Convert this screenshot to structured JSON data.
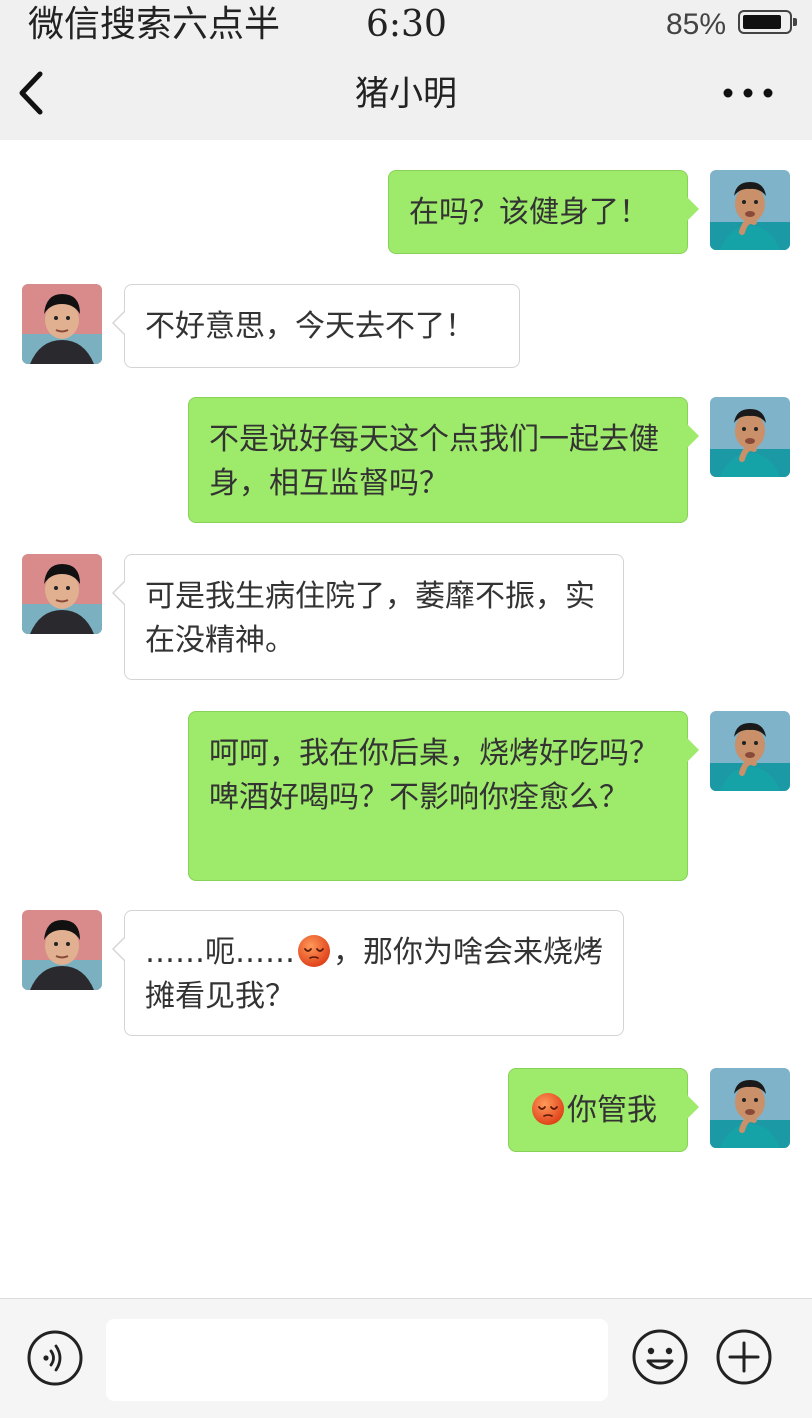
{
  "status_bar": {
    "carrier": "微信搜索六点半",
    "time": "6:30",
    "battery": "85%",
    "battery_level": 0.85
  },
  "header": {
    "back_icon": "chevron-left-icon",
    "title": "猪小明",
    "more_icon": "more-dots-icon"
  },
  "messages": [
    {
      "side": "sent",
      "text": "在吗？该健身了！"
    },
    {
      "side": "received",
      "text": "不好意思，今天去不了！"
    },
    {
      "side": "sent",
      "text": "不是说好每天这个点我们一起去健身，相互监督吗？"
    },
    {
      "side": "received",
      "text": "可是我生病住院了，萎靡不振，实在没精神。"
    },
    {
      "side": "sent",
      "text": "呵呵，我在你后桌，烧烤好吃吗？啤酒好喝吗？不影响你痊愈么？"
    },
    {
      "side": "received",
      "text_before": "……呃……",
      "emoji": "relieved-face-emoji",
      "text_after": "，那你为啥会来烧烤摊看见我？"
    },
    {
      "side": "sent",
      "emoji": "relieved-face-emoji",
      "text_after": "你管我"
    }
  ],
  "input_bar": {
    "voice_icon": "voice-icon",
    "input_value": "",
    "emoji_icon": "smiley-icon",
    "plus_icon": "plus-icon"
  },
  "colors": {
    "sent_bubble": "#9eea6a",
    "received_bubble": "#ffffff",
    "bar_background": "#f0f0f0"
  }
}
